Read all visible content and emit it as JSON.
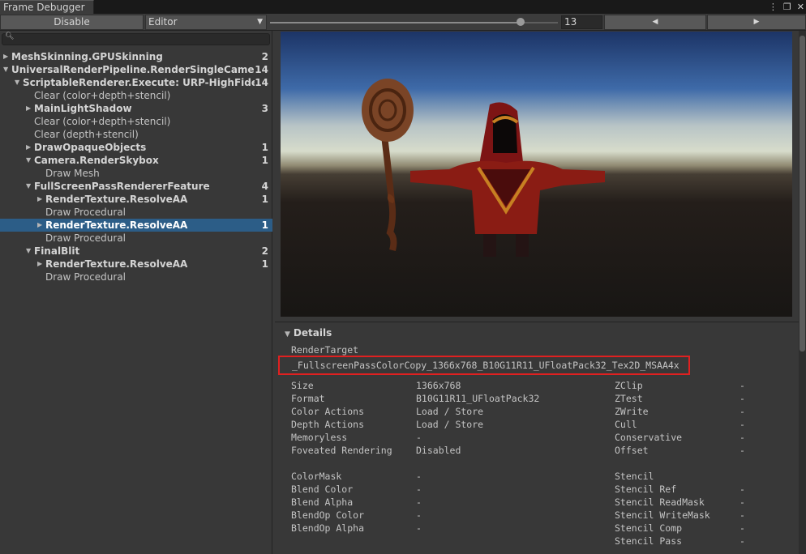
{
  "window": {
    "title": "Frame Debugger",
    "icons": [
      "more-icon",
      "maximize-icon",
      "close-icon"
    ]
  },
  "toolbar": {
    "disable_label": "Disable",
    "target_dropdown": "Editor",
    "event_index": "13",
    "event_fraction": 0.87,
    "prev_label": "◀",
    "next_label": "▶"
  },
  "search": {
    "value": ""
  },
  "tree": [
    {
      "label": "MeshSkinning.GPUSkinning",
      "count": "2",
      "depth": 0,
      "arrow": "right",
      "bold": true
    },
    {
      "label": "UniversalRenderPipeline.RenderSingleCameraInternal",
      "count": "14",
      "depth": 0,
      "arrow": "down",
      "bold": true
    },
    {
      "label": "ScriptableRenderer.Execute: URP-HighFidelity-Renderer",
      "count": "14",
      "depth": 1,
      "arrow": "down",
      "bold": true
    },
    {
      "label": "Clear (color+depth+stencil)",
      "count": "",
      "depth": 2,
      "arrow": "",
      "bold": false
    },
    {
      "label": "MainLightShadow",
      "count": "3",
      "depth": 2,
      "arrow": "right",
      "bold": true
    },
    {
      "label": "Clear (color+depth+stencil)",
      "count": "",
      "depth": 2,
      "arrow": "",
      "bold": false
    },
    {
      "label": "Clear (depth+stencil)",
      "count": "",
      "depth": 2,
      "arrow": "",
      "bold": false
    },
    {
      "label": "DrawOpaqueObjects",
      "count": "1",
      "depth": 2,
      "arrow": "right",
      "bold": true
    },
    {
      "label": "Camera.RenderSkybox",
      "count": "1",
      "depth": 2,
      "arrow": "down",
      "bold": true
    },
    {
      "label": "Draw Mesh",
      "count": "",
      "depth": 3,
      "arrow": "",
      "bold": false
    },
    {
      "label": "FullScreenPassRendererFeature",
      "count": "4",
      "depth": 2,
      "arrow": "down",
      "bold": true
    },
    {
      "label": "RenderTexture.ResolveAA",
      "count": "1",
      "depth": 3,
      "arrow": "right",
      "bold": true
    },
    {
      "label": "Draw Procedural",
      "count": "",
      "depth": 3,
      "arrow": "",
      "bold": false
    },
    {
      "label": "RenderTexture.ResolveAA",
      "count": "1",
      "depth": 3,
      "arrow": "right",
      "bold": true,
      "selected": true
    },
    {
      "label": "Draw Procedural",
      "count": "",
      "depth": 3,
      "arrow": "",
      "bold": false
    },
    {
      "label": "FinalBlit",
      "count": "2",
      "depth": 2,
      "arrow": "down",
      "bold": true
    },
    {
      "label": "RenderTexture.ResolveAA",
      "count": "1",
      "depth": 3,
      "arrow": "right",
      "bold": true
    },
    {
      "label": "Draw Procedural",
      "count": "",
      "depth": 3,
      "arrow": "",
      "bold": false
    }
  ],
  "details": {
    "header": "Details",
    "render_target_label": "RenderTarget",
    "render_target_value": "_FullscreenPassColorCopy_1366x768_B10G11R11_UFloatPack32_Tex2D_MSAA4x",
    "left_props": [
      {
        "name": "Size",
        "value": "1366x768"
      },
      {
        "name": "Format",
        "value": "B10G11R11_UFloatPack32"
      },
      {
        "name": "Color Actions",
        "value": "Load / Store"
      },
      {
        "name": "Depth Actions",
        "value": "Load / Store"
      },
      {
        "name": "Memoryless",
        "value": "-"
      },
      {
        "name": "Foveated Rendering",
        "value": "Disabled"
      },
      {
        "name": "",
        "value": ""
      },
      {
        "name": "ColorMask",
        "value": "-"
      },
      {
        "name": "Blend Color",
        "value": "-"
      },
      {
        "name": "Blend Alpha",
        "value": "-"
      },
      {
        "name": "BlendOp Color",
        "value": "-"
      },
      {
        "name": "BlendOp Alpha",
        "value": "-"
      }
    ],
    "right_props": [
      {
        "name": "ZClip",
        "value": "-"
      },
      {
        "name": "ZTest",
        "value": "-"
      },
      {
        "name": "ZWrite",
        "value": "-"
      },
      {
        "name": "Cull",
        "value": "-"
      },
      {
        "name": "Conservative",
        "value": "-"
      },
      {
        "name": "Offset",
        "value": "-"
      },
      {
        "name": "",
        "value": ""
      },
      {
        "name": "Stencil",
        "value": ""
      },
      {
        "name": "Stencil Ref",
        "value": "-"
      },
      {
        "name": "Stencil ReadMask",
        "value": "-"
      },
      {
        "name": "Stencil WriteMask",
        "value": "-"
      },
      {
        "name": "Stencil Comp",
        "value": "-"
      },
      {
        "name": "Stencil Pass",
        "value": "-"
      }
    ]
  },
  "colors": {
    "selection": "#2c5d87",
    "highlight_border": "#e02020",
    "panel": "#383838"
  }
}
